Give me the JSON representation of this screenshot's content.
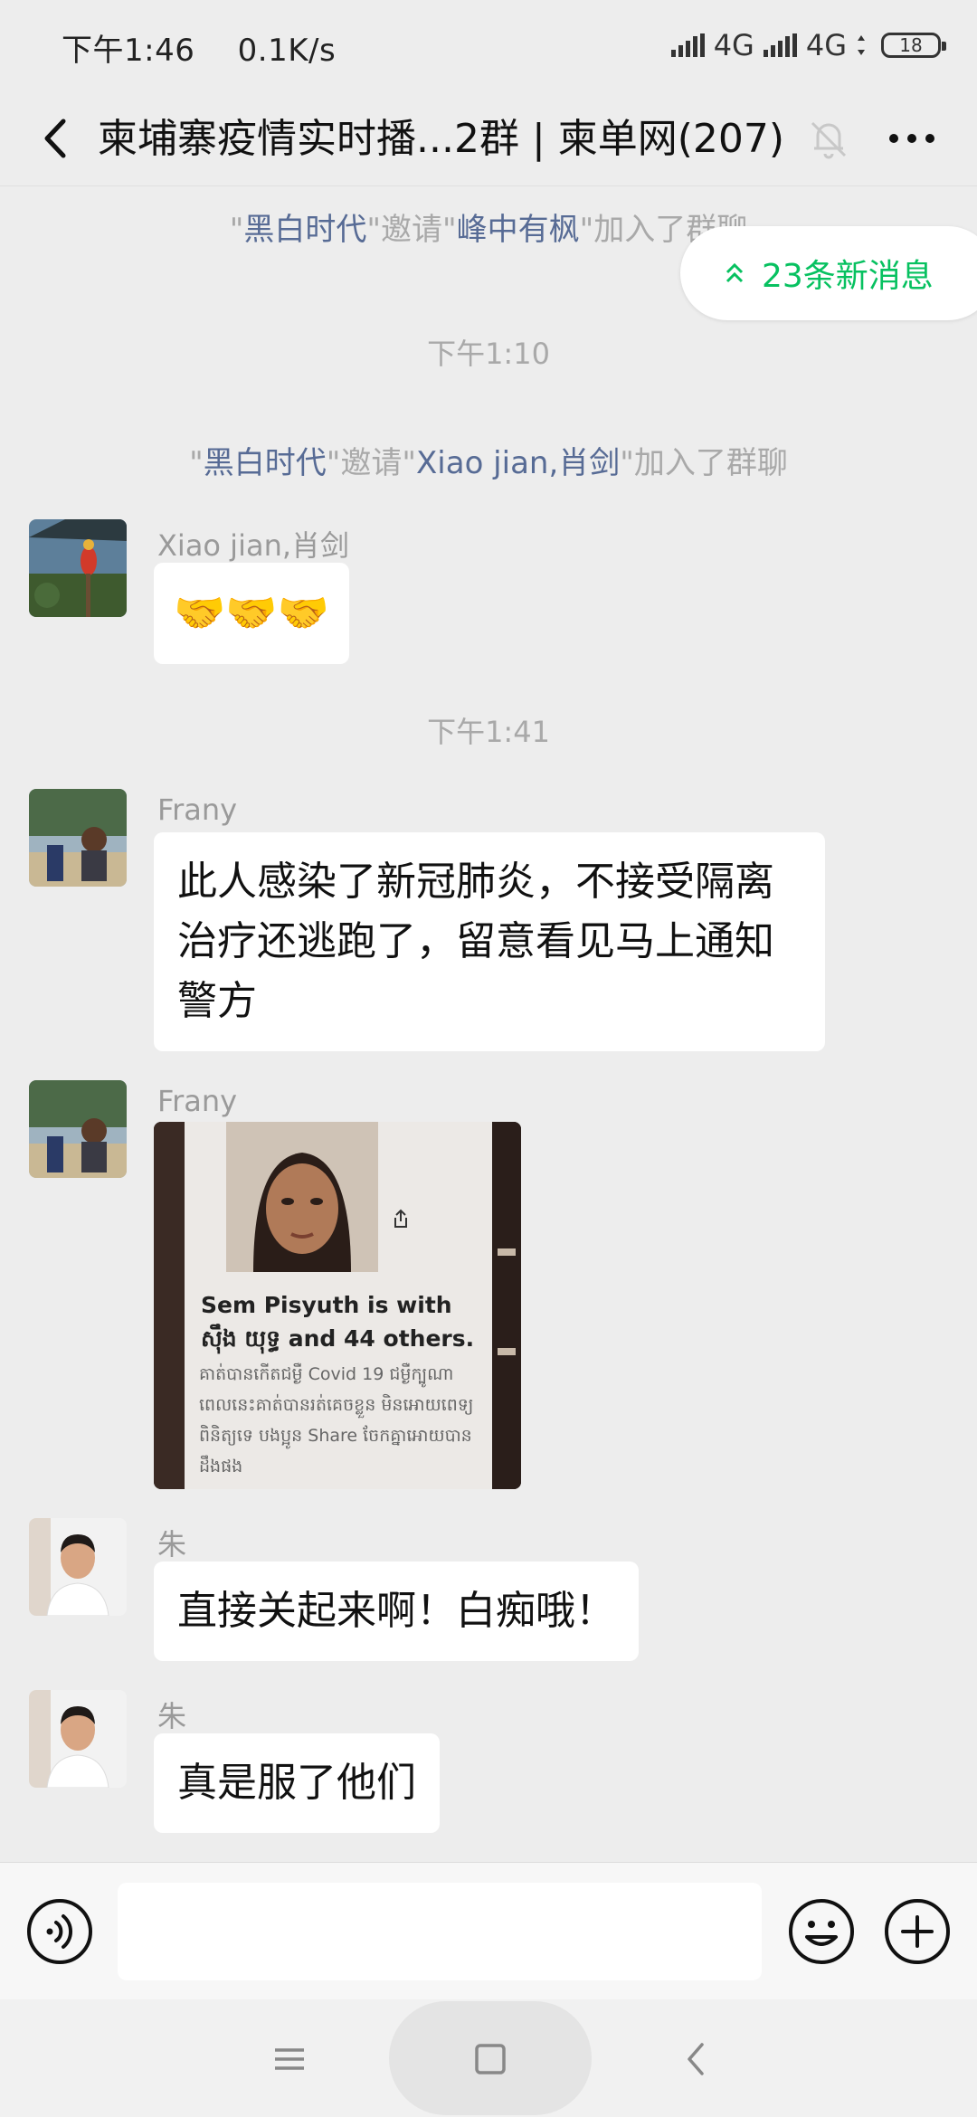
{
  "status_bar": {
    "time": "下午1:46",
    "speed": "0.1K/s",
    "network1": "4G",
    "network2": "4G",
    "battery": "18"
  },
  "header": {
    "title": "柬埔寨疫情实时播...2群 | 柬单网(207)"
  },
  "new_messages": {
    "label": "23条新消息"
  },
  "system_messages": [
    {
      "q1": "\"",
      "inviter": "黑白时代",
      "q2": "\"邀请\"",
      "invitee": "峰中有枫",
      "q3": "\"加入了群聊"
    },
    {
      "q1": "\"",
      "inviter": "黑白时代",
      "q2": "\"邀请\"",
      "invitee": "Xiao jian,肖剑",
      "q3": "\"加入了群聊"
    }
  ],
  "timestamps": [
    "下午1:10",
    "下午1:41"
  ],
  "messages": [
    {
      "sender": "Xiao jian,肖剑",
      "text": "🤝🤝🤝"
    },
    {
      "sender": "Frany",
      "line1": "此人感染了新冠肺炎，不接受隔离",
      "line2": "治疗还逃跑了，留意看见马上通知",
      "line3": "警方"
    },
    {
      "sender": "Frany",
      "image_caption": "Sem Pisyuth is with ស៊ឹង យុទ្ធ and 44 others.",
      "image_sub": "គាត់បានកើតជម្ងឺ Covid 19 ជម្ងឺក្បូណា ពេលនេះគាត់បានរត់គេចខ្លួន មិនអោយពេទ្យពិនិត្យទេ បងប្អូន Share ចែកគ្នាអោយបានដឹងផង"
    },
    {
      "sender": "朱",
      "text": "直接关起来啊！白痴哦！"
    },
    {
      "sender": "朱",
      "text": "真是服了他们"
    }
  ],
  "input": {
    "placeholder": ""
  },
  "colors": {
    "background": "#ededed",
    "accent_green": "#07c160",
    "link_blue": "#576b95"
  }
}
